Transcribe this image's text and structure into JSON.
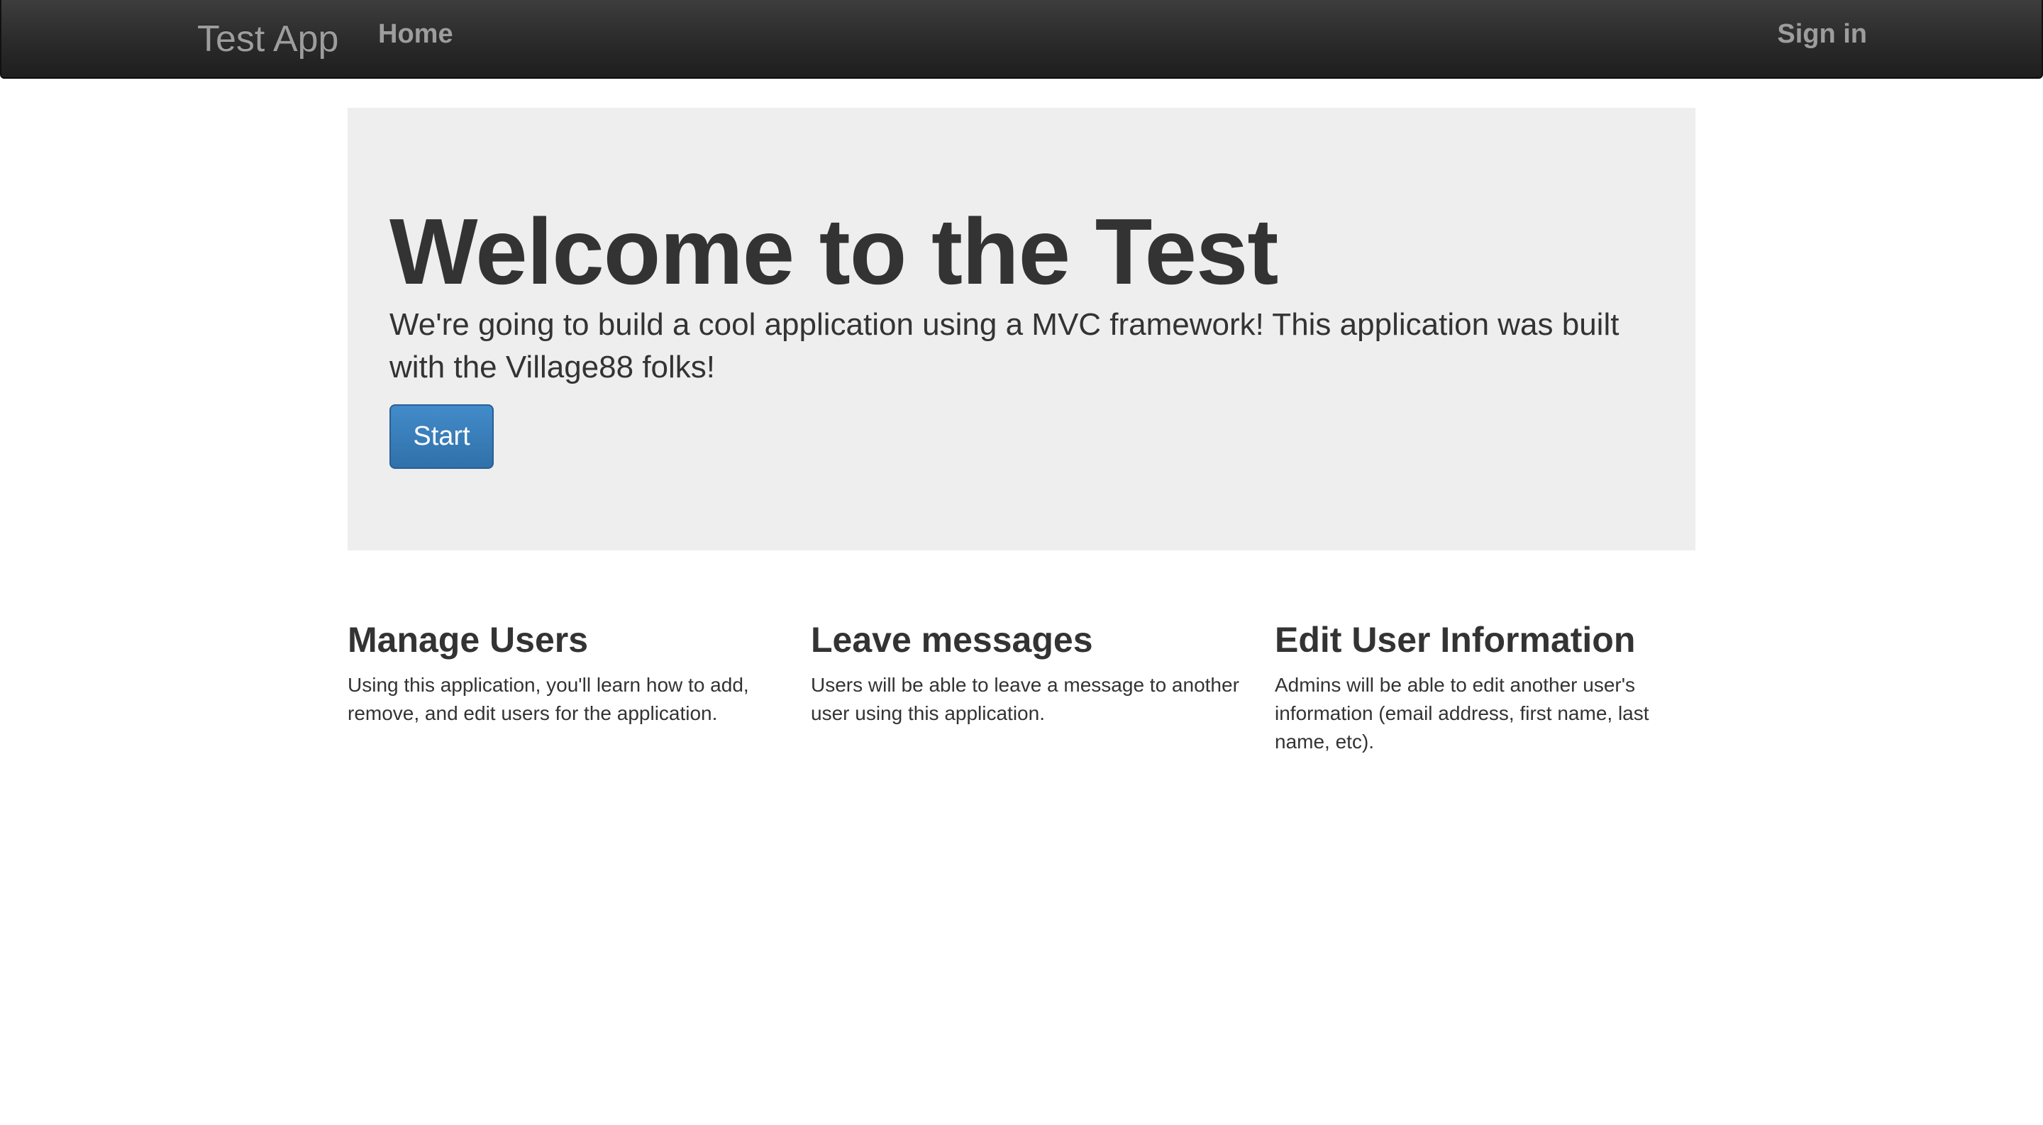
{
  "navbar": {
    "brand": "Test App",
    "home": "Home",
    "signin": "Sign in"
  },
  "jumbotron": {
    "title": "Welcome to the Test",
    "text": "We're going to build a cool application using a MVC framework! This application was built with the Village88 folks!",
    "button_label": "Start"
  },
  "features": [
    {
      "title": "Manage Users",
      "text": "Using this application, you'll learn how to add, remove, and edit users for the application."
    },
    {
      "title": "Leave messages",
      "text": "Users will be able to leave a message to another user using this application."
    },
    {
      "title": "Edit User Information",
      "text": "Admins will be able to edit another user's information (email address, first name, last name, etc)."
    }
  ],
  "colors": {
    "navbar_bg": "#2a2a2a",
    "nav_text": "#9d9d9d",
    "jumbotron_bg": "#eeeeee",
    "primary_button": "#3071a9",
    "body_text": "#333333"
  }
}
